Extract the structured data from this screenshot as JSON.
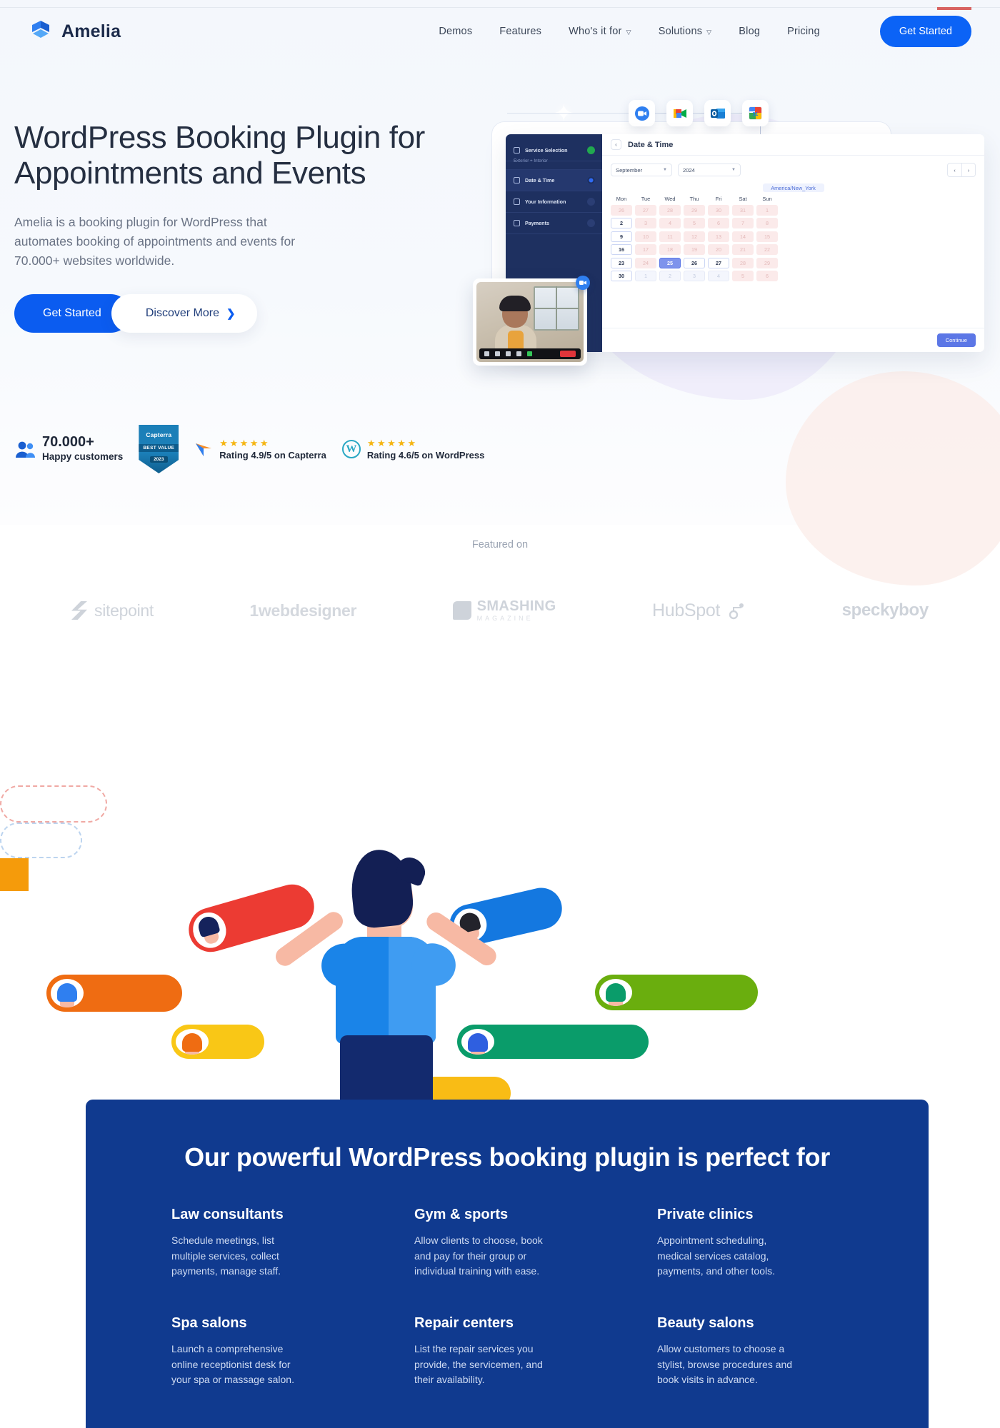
{
  "header": {
    "brand": "Amelia",
    "nav": [
      {
        "label": "Demos",
        "caret": false
      },
      {
        "label": "Features",
        "caret": false
      },
      {
        "label": "Who's it for",
        "caret": true
      },
      {
        "label": "Solutions",
        "caret": true
      },
      {
        "label": "Blog",
        "caret": false
      },
      {
        "label": "Pricing",
        "caret": false
      }
    ],
    "cta": "Get Started"
  },
  "hero": {
    "title": "WordPress Booking Plugin for Appointments and Events",
    "subtitle": "Amelia is a booking plugin for WordPress that automates booking of appointments and events for 70.000+ websites worldwide.",
    "primary_cta": "Get Started",
    "secondary_cta": "Discover More",
    "secondary_icon": "chevron-right-icon"
  },
  "ratings": {
    "customers_count": "70.000+",
    "customers_label": "Happy customers",
    "badge": {
      "brand": "Capterra",
      "line1": "BEST VALUE",
      "year": "2023"
    },
    "items": [
      {
        "stars": "★★★★★",
        "text": "Rating 4.9/5 on Capterra",
        "icon": "capterra-icon"
      },
      {
        "stars": "★★★★★",
        "text": "Rating 4.6/5 on WordPress",
        "icon": "wordpress-icon"
      }
    ]
  },
  "mockup": {
    "integrations": [
      "zoom-icon",
      "google-meet-icon",
      "outlook-icon",
      "google-calendar-icon"
    ],
    "calendar_day_badge": "31",
    "sidebar": [
      {
        "label": "Service Selection",
        "sub": "Exterior + Interior",
        "status": "done"
      },
      {
        "label": "Date & Time",
        "sub": "",
        "status": "current"
      },
      {
        "label": "Your Information",
        "sub": "",
        "status": "off"
      },
      {
        "label": "Payments",
        "sub": "",
        "status": "off"
      }
    ],
    "panel_title": "Date & Time",
    "back_icon": "chevron-left-icon",
    "month": "September",
    "year": "2024",
    "prev_icon": "chevron-left-icon",
    "next_icon": "chevron-right-icon",
    "timezone": "America/New_York",
    "dow": [
      "Mon",
      "Tue",
      "Wed",
      "Thu",
      "Fri",
      "Sat",
      "Sun"
    ],
    "weeks": [
      [
        {
          "d": "26",
          "s": "dis"
        },
        {
          "d": "27",
          "s": "dis"
        },
        {
          "d": "28",
          "s": "dis"
        },
        {
          "d": "29",
          "s": "dis"
        },
        {
          "d": "30",
          "s": "dis"
        },
        {
          "d": "31",
          "s": "dis"
        },
        {
          "d": "1",
          "s": "dis"
        }
      ],
      [
        {
          "d": "2",
          "s": "sel"
        },
        {
          "d": "3",
          "s": "dis"
        },
        {
          "d": "4",
          "s": "dis"
        },
        {
          "d": "5",
          "s": "dis"
        },
        {
          "d": "6",
          "s": "dis"
        },
        {
          "d": "7",
          "s": "dis"
        },
        {
          "d": "8",
          "s": "dis"
        }
      ],
      [
        {
          "d": "9",
          "s": "sel"
        },
        {
          "d": "10",
          "s": "dis"
        },
        {
          "d": "11",
          "s": "dis"
        },
        {
          "d": "12",
          "s": "dis"
        },
        {
          "d": "13",
          "s": "dis"
        },
        {
          "d": "14",
          "s": "dis"
        },
        {
          "d": "15",
          "s": "dis"
        }
      ],
      [
        {
          "d": "16",
          "s": "sel"
        },
        {
          "d": "17",
          "s": "dis"
        },
        {
          "d": "18",
          "s": "dis"
        },
        {
          "d": "19",
          "s": "dis"
        },
        {
          "d": "20",
          "s": "dis"
        },
        {
          "d": "21",
          "s": "dis"
        },
        {
          "d": "22",
          "s": "dis"
        }
      ],
      [
        {
          "d": "23",
          "s": "sel"
        },
        {
          "d": "24",
          "s": "dis"
        },
        {
          "d": "25",
          "s": "hl"
        },
        {
          "d": "26",
          "s": "sel"
        },
        {
          "d": "27",
          "s": "sel"
        },
        {
          "d": "28",
          "s": "dis"
        },
        {
          "d": "29",
          "s": "dis"
        }
      ],
      [
        {
          "d": "30",
          "s": "sel"
        },
        {
          "d": "1",
          "s": "out"
        },
        {
          "d": "2",
          "s": "out"
        },
        {
          "d": "3",
          "s": "out"
        },
        {
          "d": "4",
          "s": "out"
        },
        {
          "d": "5",
          "s": "dis"
        },
        {
          "d": "6",
          "s": "dis"
        }
      ]
    ],
    "continue": "Continue",
    "video_badge": "zoom-icon"
  },
  "featured": {
    "label": "Featured on",
    "logos": [
      {
        "name": "sitepoint",
        "text": "sitepoint"
      },
      {
        "name": "1stwebdesigner",
        "text": "1webdesigner"
      },
      {
        "name": "smashing-magazine",
        "text": "SMASHING",
        "sub": "MAGAZINE"
      },
      {
        "name": "hubspot",
        "text": "HubSpot"
      },
      {
        "name": "speckyboy",
        "text": "speckyboy"
      }
    ]
  },
  "perfect_for": {
    "title": "Our powerful WordPress booking plugin is perfect for",
    "items": [
      {
        "heading": "Law consultants",
        "body": "Schedule meetings, list multiple services, collect payments, manage staff."
      },
      {
        "heading": "Gym & sports",
        "body": "Allow clients to choose, book and pay for their group or individual training with ease."
      },
      {
        "heading": "Private clinics",
        "body": "Appointment scheduling, medical services catalog, payments, and other tools."
      },
      {
        "heading": "Spa salons",
        "body": "Launch a comprehensive online receptionist desk for your spa or massage salon."
      },
      {
        "heading": "Repair centers",
        "body": "List the repair services you provide, the servicemen, and their availability."
      },
      {
        "heading": "Beauty salons",
        "body": "Allow customers to choose a stylist, browse procedures and book visits in advance."
      }
    ]
  },
  "colors": {
    "brand_blue": "#0b5cf0",
    "deep_blue": "#103a8f",
    "sidebar_navy": "#1e3060",
    "star_gold": "#f5b512",
    "accent_red": "#d0312d"
  }
}
